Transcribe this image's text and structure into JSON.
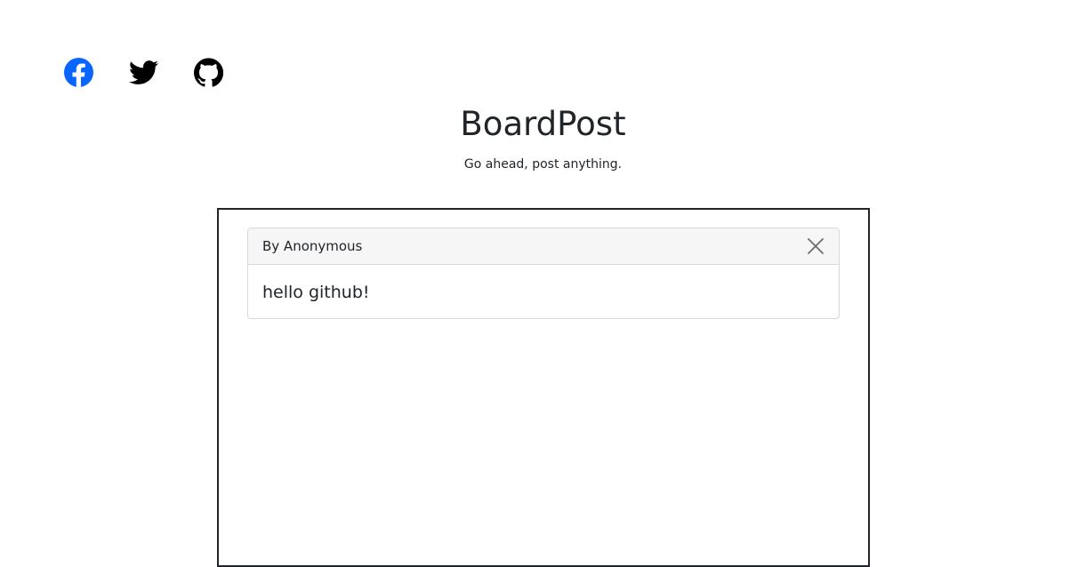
{
  "social": [
    {
      "name": "facebook",
      "icon": "facebook-icon",
      "color": "#0866ff"
    },
    {
      "name": "twitter",
      "icon": "twitter-icon",
      "color": "#000000"
    },
    {
      "name": "github",
      "icon": "github-icon",
      "color": "#000000"
    }
  ],
  "header": {
    "title": "BoardPost",
    "subtitle": "Go ahead, post anything."
  },
  "board": {
    "posts": [
      {
        "author": "By Anonymous",
        "content": "hello github!",
        "close_icon": "close-icon"
      }
    ]
  }
}
